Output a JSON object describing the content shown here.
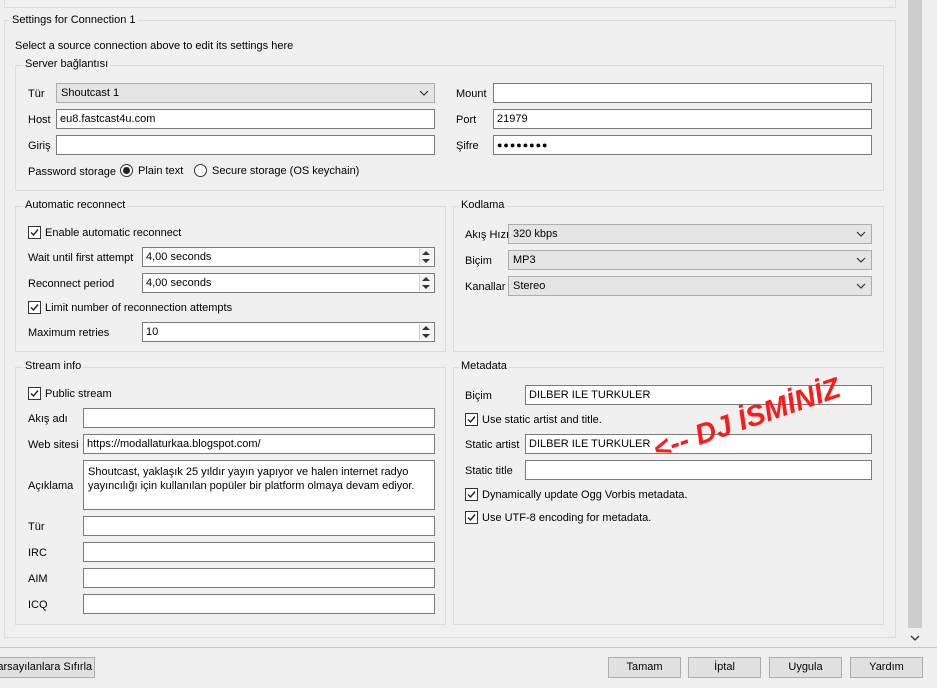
{
  "connection_group": {
    "title": "Settings for Connection 1",
    "hint": "Select a source connection above to edit its settings here"
  },
  "server": {
    "title": "Server bağlantısı",
    "type_label": "Tür",
    "type_value": "Shoutcast 1",
    "host_label": "Host",
    "host_value": "eu8.fastcast4u.com",
    "login_label": "Giriş",
    "login_value": "",
    "mount_label": "Mount",
    "mount_value": "",
    "port_label": "Port",
    "port_value": "21979",
    "password_label": "Şifre",
    "password_value": "●●●●●●●●",
    "storage_label": "Password storage",
    "storage_plain": "Plain text",
    "storage_secure": "Secure storage (OS keychain)"
  },
  "reconnect": {
    "title": "Automatic reconnect",
    "enable_label": "Enable automatic reconnect",
    "wait_label": "Wait until first attempt",
    "wait_value": "4,00 seconds",
    "period_label": "Reconnect period",
    "period_value": "4,00 seconds",
    "limit_label": "Limit number of reconnection attempts",
    "max_label": "Maximum retries",
    "max_value": "10"
  },
  "encoding": {
    "title": "Kodlama",
    "bitrate_label": "Akış Hızı",
    "bitrate_value": "320 kbps",
    "format_label": "Biçim",
    "format_value": "MP3",
    "channels_label": "Kanallar",
    "channels_value": "Stereo"
  },
  "stream_info": {
    "title": "Stream info",
    "public_label": "Public stream",
    "name_label": "Akış adı",
    "name_value": "",
    "website_label": "Web sitesi",
    "website_value": "https://modallaturkaa.blogspot.com/",
    "desc_label": "Açıklama",
    "desc_value": "Shoutcast, yaklaşık 25 yıldır yayın yapıyor ve halen internet radyo yayıncılığı için kullanılan popüler bir platform olmaya devam ediyor.",
    "genre_label": "Tür",
    "genre_value": "",
    "irc_label": "IRC",
    "irc_value": "",
    "aim_label": "AIM",
    "aim_value": "",
    "icq_label": "ICQ",
    "icq_value": ""
  },
  "metadata": {
    "title": "Metadata",
    "format_label": "Biçim",
    "format_value": "DILBER ILE TURKULER",
    "static_check_label": "Use static artist and title.",
    "artist_label": "Static artist",
    "artist_value": "DILBER ILE TURKULER",
    "title_label": "Static title",
    "title_value": "",
    "ogg_label": "Dynamically update Ogg Vorbis metadata.",
    "utf8_label": "Use UTF-8 encoding for metadata."
  },
  "annotation": {
    "text": "<-- DJ İSMİNİZ",
    "color": "#ff1a1a"
  },
  "buttons": {
    "reset": "Varsayılanlara Sıfırla",
    "ok": "Tamam",
    "cancel": "İptal",
    "apply": "Uygula",
    "help": "Yardım"
  }
}
